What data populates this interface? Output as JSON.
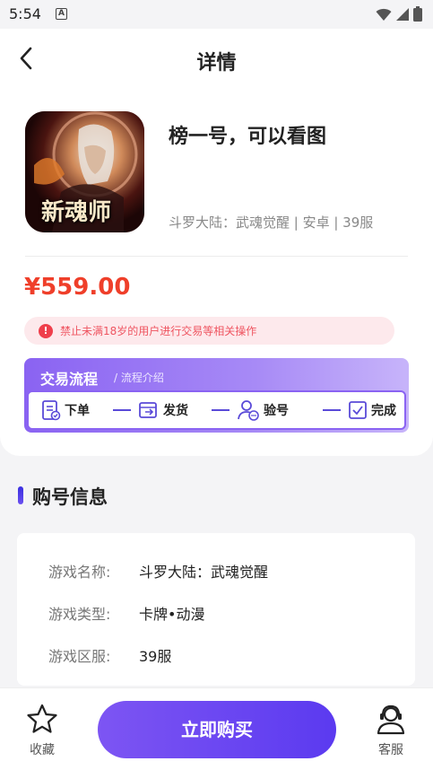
{
  "status": {
    "time": "5:54",
    "a_icon": "A"
  },
  "header": {
    "title": "详情"
  },
  "game": {
    "title": "榜一号，可以看图",
    "meta": "斗罗大陆：武魂觉醒 | 安卓 | 39服",
    "icon_text": "新魂师"
  },
  "price": "¥559.00",
  "warning": {
    "text": "禁止未满18岁的用户进行交易等相关操作",
    "icon": "!"
  },
  "flow": {
    "title": "交易流程",
    "subtitle": "/ 流程介绍",
    "steps": [
      "下单",
      "发货",
      "验号",
      "完成"
    ]
  },
  "section": {
    "title": "购号信息"
  },
  "info": {
    "rows": [
      {
        "label": "游戏名称:",
        "value": "斗罗大陆：武魂觉醒"
      },
      {
        "label": "游戏类型:",
        "value": "卡牌•动漫"
      },
      {
        "label": "游戏区服:",
        "value": "39服"
      }
    ]
  },
  "bottom": {
    "fav_label": "收藏",
    "buy_label": "立即购买",
    "service_label": "客服"
  },
  "colors": {
    "accent": "#6a4ff0",
    "price": "#ef3f2a",
    "warning_bg": "#fde9ec"
  }
}
